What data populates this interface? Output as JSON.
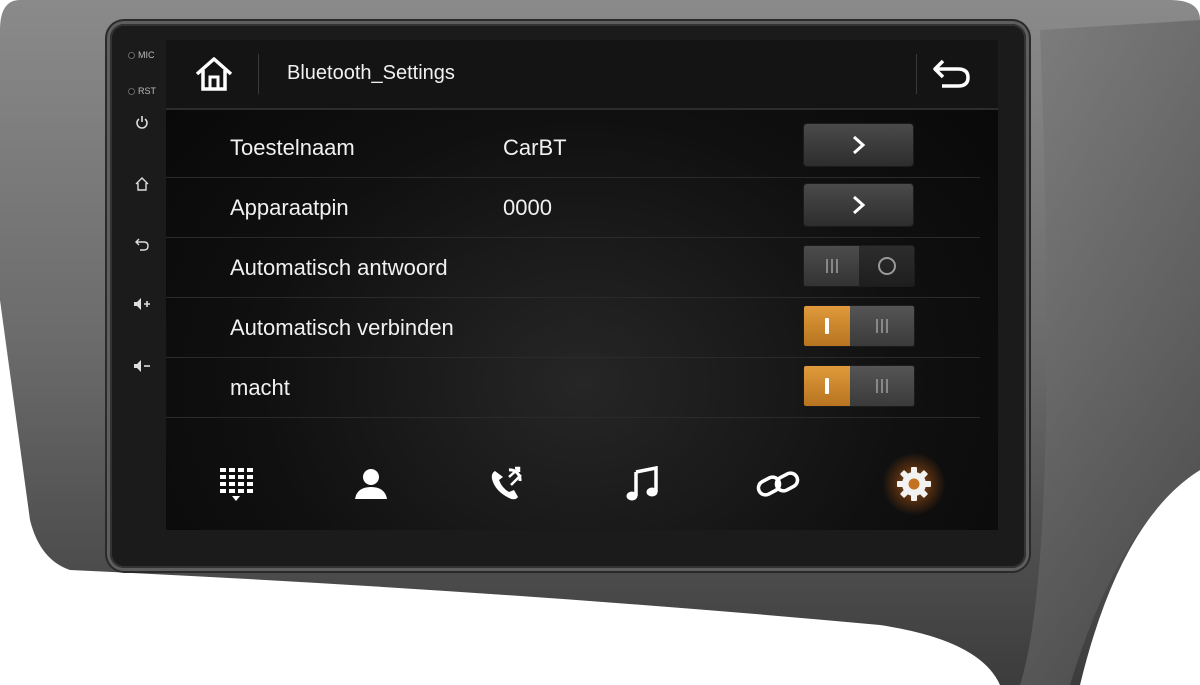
{
  "side_panel": {
    "mic_label": "MIC",
    "rst_label": "RST",
    "icons": [
      "power-icon",
      "home-icon",
      "back-icon",
      "volume-up-icon",
      "volume-down-icon"
    ]
  },
  "header": {
    "title": "Bluetooth_Settings",
    "home_icon": "home-icon",
    "back_icon": "back-arrow-icon"
  },
  "settings": [
    {
      "label": "Toestelnaam",
      "value": "CarBT",
      "control": "arrow"
    },
    {
      "label": "Apparaatpin",
      "value": "0000",
      "control": "arrow"
    },
    {
      "label": "Automatisch antwoord",
      "value": "",
      "control": "toggle",
      "state": "off"
    },
    {
      "label": "Automatisch verbinden",
      "value": "",
      "control": "toggle",
      "state": "on"
    },
    {
      "label": "macht",
      "value": "",
      "control": "toggle",
      "state": "on"
    }
  ],
  "bottom_nav": [
    {
      "icon": "dialpad-icon",
      "active": false
    },
    {
      "icon": "contacts-icon",
      "active": false
    },
    {
      "icon": "call-log-icon",
      "active": false
    },
    {
      "icon": "music-icon",
      "active": false
    },
    {
      "icon": "link-icon",
      "active": false
    },
    {
      "icon": "settings-gear-icon",
      "active": true
    }
  ],
  "colors": {
    "accent": "#e09a3c",
    "screen_bg": "#0b0b0b",
    "bezel": "#6a6a6a",
    "text": "#f0f0f0"
  }
}
